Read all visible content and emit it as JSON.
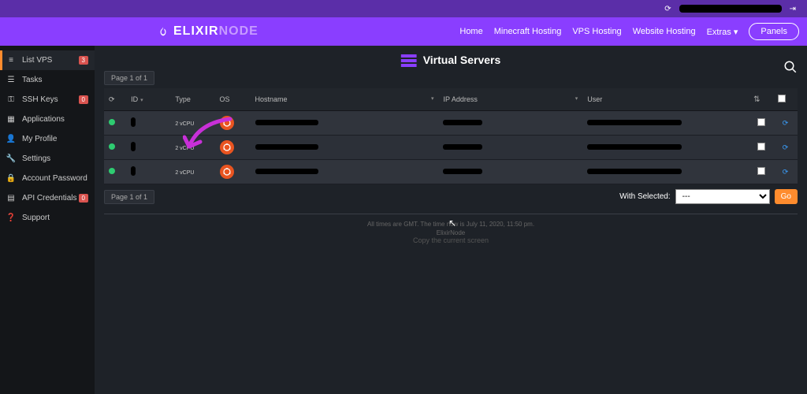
{
  "brand": {
    "part1": "ELIXIR",
    "part2": "NODE"
  },
  "nav": {
    "home": "Home",
    "minecraft": "Minecraft Hosting",
    "vps": "VPS Hosting",
    "website": "Website Hosting",
    "extras": "Extras",
    "panels": "Panels"
  },
  "sidebar": {
    "items": [
      {
        "label": "List VPS",
        "icon": "list-icon",
        "badge": "3",
        "active": true
      },
      {
        "label": "Tasks",
        "icon": "tasks-icon"
      },
      {
        "label": "SSH Keys",
        "icon": "key-icon",
        "badge": "0"
      },
      {
        "label": "Applications",
        "icon": "apps-icon"
      },
      {
        "label": "My Profile",
        "icon": "user-icon"
      },
      {
        "label": "Settings",
        "icon": "wrench-icon"
      },
      {
        "label": "Account Password",
        "icon": "lock-icon"
      },
      {
        "label": "API Credentials",
        "icon": "grid-icon",
        "badge": "0"
      },
      {
        "label": "Support",
        "icon": "support-icon"
      }
    ]
  },
  "page": {
    "title": "Virtual Servers",
    "page_label_top": "Page 1 of 1",
    "page_label_bottom": "Page 1 of 1",
    "with_selected_label": "With Selected:",
    "with_selected_value": "---",
    "go_label": "Go",
    "copy_hint": "Copy the current screen"
  },
  "table": {
    "headers": {
      "id": "ID",
      "type": "Type",
      "os": "OS",
      "hostname": "Hostname",
      "ip": "IP Address",
      "user": "User"
    },
    "rows": [
      {
        "status": "up",
        "type": "2 vCPU",
        "os": "ubuntu"
      },
      {
        "status": "up",
        "type": "2 vCPU",
        "os": "ubuntu"
      },
      {
        "status": "up",
        "type": "2 vCPU",
        "os": "ubuntu"
      }
    ]
  },
  "footer": {
    "line1": "All times are GMT. The time now is July 11, 2020, 11:50 pm.",
    "line2": "ElixirNode"
  },
  "colors": {
    "accent": "#ff8c2e",
    "purple_dark": "#5b2ea8",
    "purple": "#8a3eff",
    "green": "#2ecc71",
    "ubuntu": "#e95420"
  }
}
